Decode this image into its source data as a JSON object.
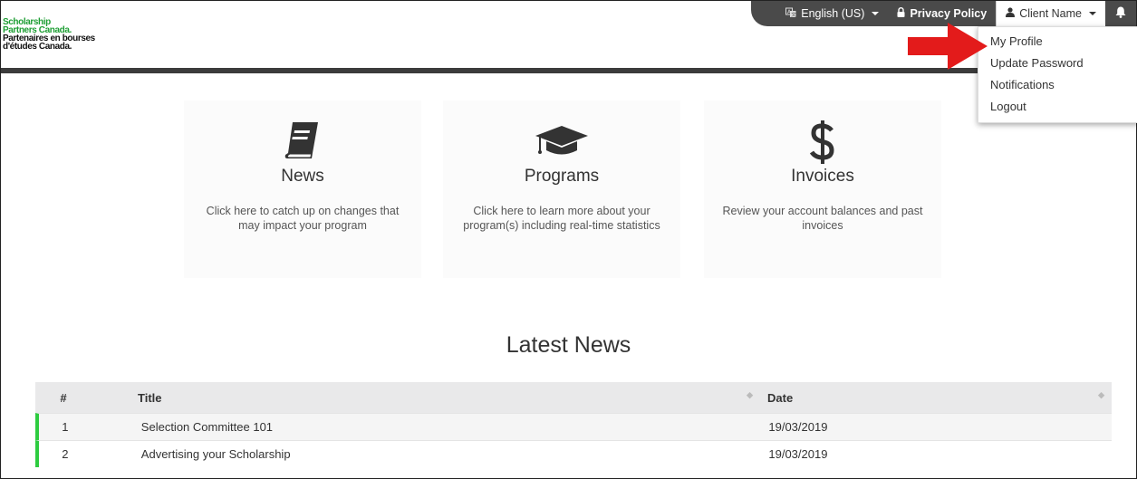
{
  "logo": {
    "line1": "Scholarship",
    "line2": "Partners Canada.",
    "line3": "Partenaires en bourses",
    "line4": "d'études Canada."
  },
  "topbar": {
    "language": "English (US)",
    "privacy": "Privacy Policy",
    "client": "Client Name"
  },
  "dropdown": {
    "items": [
      "My Profile",
      "Update Password",
      "Notifications",
      "Logout"
    ]
  },
  "cards": [
    {
      "title": "News",
      "desc": "Click here to catch up on changes that may impact your program",
      "icon": "book-icon"
    },
    {
      "title": "Programs",
      "desc": "Click here to learn more about your program(s) including real-time statistics",
      "icon": "graduation-cap-icon"
    },
    {
      "title": "Invoices",
      "desc": "Review your account balances and past invoices",
      "icon": "dollar-icon"
    }
  ],
  "latest_news": {
    "heading": "Latest News",
    "columns": [
      "#",
      "Title",
      "Date"
    ],
    "rows": [
      {
        "num": "1",
        "title": "Selection Committee 101",
        "date": "19/03/2019"
      },
      {
        "num": "2",
        "title": "Advertising your Scholarship",
        "date": "19/03/2019"
      }
    ]
  },
  "colors": {
    "brand_green": "#1e9e34",
    "row_accent": "#2ecc40",
    "topbar_dark": "#4a4a4a",
    "annotation_red": "#e31b1b"
  }
}
